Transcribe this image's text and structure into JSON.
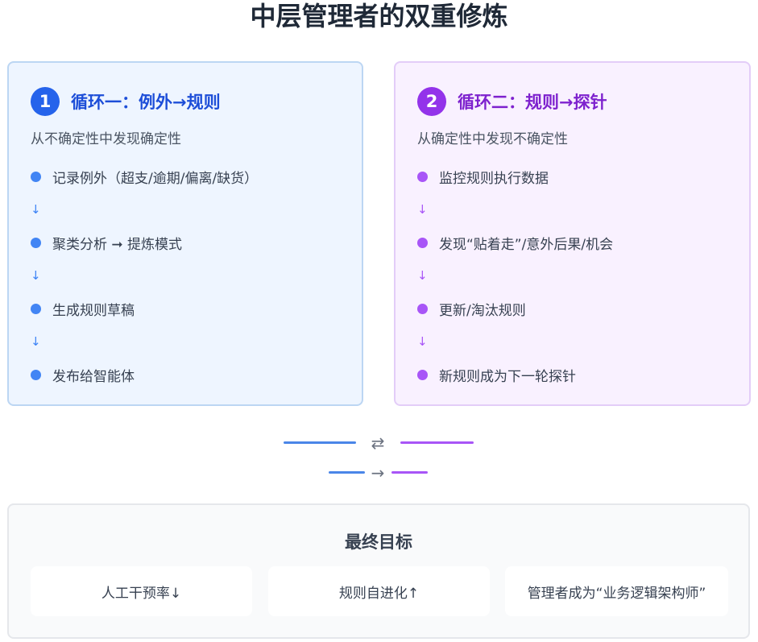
{
  "title": "中层管理者的双重修炼",
  "loop1": {
    "number": "1",
    "title": "循环一：例外→规则",
    "subtitle": "从不确定性中发现确定性",
    "color": "#2563eb",
    "steps": [
      "记录例外（超支/逾期/偏离/缺货）",
      "聚类分析 ➞ 提炼模式",
      "生成规则草稿",
      "发布给智能体"
    ],
    "arrow": "↓"
  },
  "loop2": {
    "number": "2",
    "title": "循环二：规则→探针",
    "subtitle": "从确定性中发现不确定性",
    "color": "#9333ea",
    "steps": [
      "监控规则执行数据",
      "发现“贴着走”/意外后果/机会",
      "更新/淘汰规则",
      "新规则成为下一轮探针"
    ],
    "arrow": "↓"
  },
  "connectors": {
    "exchange_symbol": "⇄",
    "forward_symbol": "→"
  },
  "goal": {
    "title": "最终目标",
    "items": [
      "人工干预率↓",
      "规则自进化↑",
      "管理者成为“业务逻辑架构师”"
    ]
  }
}
